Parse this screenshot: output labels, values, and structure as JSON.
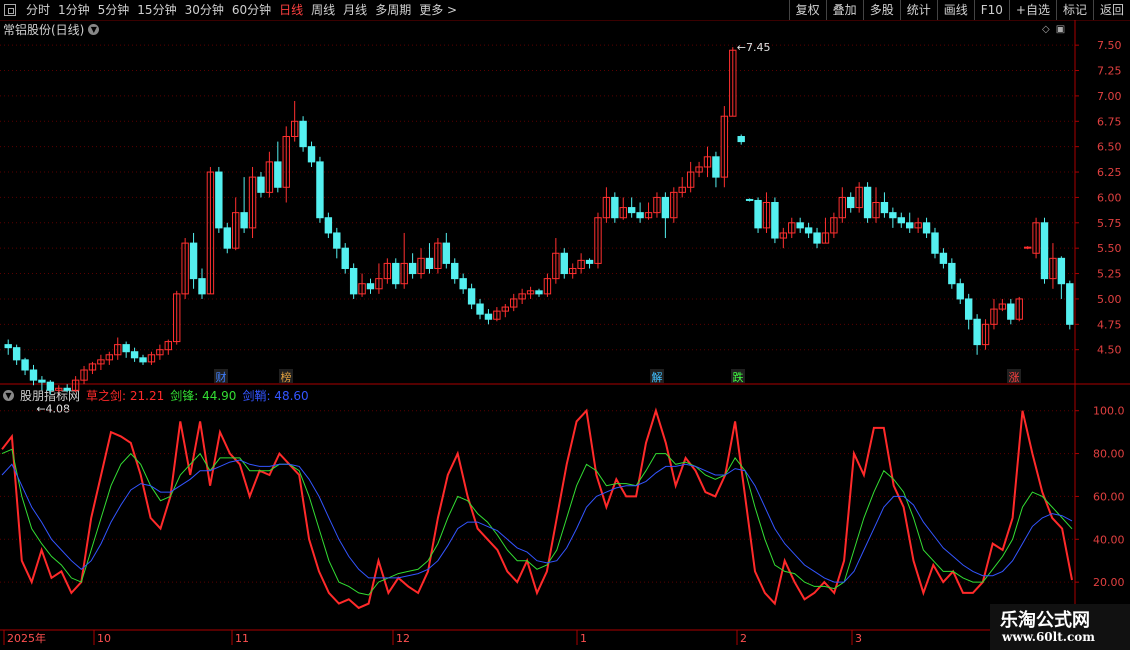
{
  "toolbar": {
    "periods": [
      "分时",
      "1分钟",
      "5分钟",
      "15分钟",
      "30分钟",
      "60分钟",
      "日线",
      "周线",
      "月线",
      "多周期",
      "更多 >"
    ],
    "active_period": "日线",
    "right_buttons": [
      "复权",
      "叠加",
      "多股",
      "统计",
      "画线",
      "F10",
      "+自选",
      "标记",
      "返回"
    ]
  },
  "main_chart": {
    "title": "常铝股份(日线)",
    "high_label": "7.45",
    "low_label": "4.08",
    "y_ticks": [
      "7.50",
      "7.25",
      "7.00",
      "6.75",
      "6.50",
      "6.25",
      "6.00",
      "5.75",
      "5.50",
      "5.25",
      "5.00",
      "4.75",
      "4.50"
    ],
    "event_markers": [
      "财",
      "榜",
      "解",
      "跌",
      "涨"
    ]
  },
  "indicator": {
    "name": "股朋指标网",
    "series_labels": [
      {
        "label": "草之剑: 21.21",
        "color": "#ff2a2a"
      },
      {
        "label": "剑锋: 44.90",
        "color": "#33dd33"
      },
      {
        "label": "剑鞘: 48.60",
        "color": "#3355ff"
      }
    ],
    "y_ticks": [
      "100.0",
      "80.00",
      "60.00",
      "40.00",
      "20.00"
    ]
  },
  "x_axis": {
    "labels": [
      "2025年",
      "10",
      "11",
      "12",
      "1",
      "2",
      "3"
    ]
  },
  "watermark": {
    "line1": "乐淘公式网",
    "line2": "www.60lt.com"
  },
  "colors": {
    "up": "#ff3030",
    "down": "#54f0f0",
    "grid": "#5a0000",
    "axis": "#aa0000"
  },
  "chart_data": [
    {
      "type": "candlestick",
      "ylim": [
        4.3,
        7.6
      ],
      "candles": [
        [
          4.55,
          4.52,
          4.6,
          4.45
        ],
        [
          4.52,
          4.4,
          4.55,
          4.35
        ],
        [
          4.4,
          4.3,
          4.42,
          4.25
        ],
        [
          4.3,
          4.2,
          4.35,
          4.15
        ],
        [
          4.2,
          4.18,
          4.24,
          4.1
        ],
        [
          4.18,
          4.1,
          4.2,
          4.06
        ],
        [
          4.1,
          4.12,
          4.15,
          4.08
        ],
        [
          4.12,
          4.1,
          4.16,
          4.08
        ],
        [
          4.1,
          4.2,
          4.24,
          4.08
        ],
        [
          4.2,
          4.3,
          4.34,
          4.16
        ],
        [
          4.3,
          4.36,
          4.38,
          4.26
        ],
        [
          4.36,
          4.4,
          4.45,
          4.3
        ],
        [
          4.4,
          4.45,
          4.48,
          4.35
        ],
        [
          4.45,
          4.55,
          4.62,
          4.4
        ],
        [
          4.55,
          4.48,
          4.58,
          4.42
        ],
        [
          4.48,
          4.42,
          4.52,
          4.38
        ],
        [
          4.42,
          4.38,
          4.45,
          4.35
        ],
        [
          4.38,
          4.45,
          4.48,
          4.35
        ],
        [
          4.45,
          4.5,
          4.55,
          4.4
        ],
        [
          4.5,
          4.58,
          4.6,
          4.45
        ],
        [
          4.58,
          5.05,
          5.08,
          4.55
        ],
        [
          5.05,
          5.55,
          5.6,
          5.0
        ],
        [
          5.55,
          5.2,
          5.65,
          5.1
        ],
        [
          5.2,
          5.05,
          5.3,
          5.0
        ],
        [
          5.05,
          6.25,
          6.3,
          5.05
        ],
        [
          6.25,
          5.7,
          6.3,
          5.65
        ],
        [
          5.7,
          5.5,
          5.75,
          5.45
        ],
        [
          5.5,
          5.85,
          6.0,
          5.48
        ],
        [
          5.85,
          5.7,
          6.2,
          5.65
        ],
        [
          5.7,
          6.2,
          6.3,
          5.6
        ],
        [
          6.2,
          6.05,
          6.25,
          6.0
        ],
        [
          6.05,
          6.35,
          6.45,
          6.0
        ],
        [
          6.35,
          6.1,
          6.55,
          6.05
        ],
        [
          6.1,
          6.6,
          6.7,
          5.95
        ],
        [
          6.6,
          6.75,
          6.95,
          6.55
        ],
        [
          6.75,
          6.5,
          6.8,
          6.45
        ],
        [
          6.5,
          6.35,
          6.55,
          6.3
        ],
        [
          6.35,
          5.8,
          6.4,
          5.75
        ],
        [
          5.8,
          5.65,
          5.85,
          5.6
        ],
        [
          5.65,
          5.5,
          5.7,
          5.4
        ],
        [
          5.5,
          5.3,
          5.55,
          5.25
        ],
        [
          5.3,
          5.05,
          5.35,
          5.0
        ],
        [
          5.05,
          5.15,
          5.25,
          5.02
        ],
        [
          5.15,
          5.1,
          5.2,
          5.05
        ],
        [
          5.1,
          5.2,
          5.35,
          5.05
        ],
        [
          5.2,
          5.35,
          5.4,
          5.15
        ],
        [
          5.35,
          5.15,
          5.4,
          5.1
        ],
        [
          5.15,
          5.35,
          5.65,
          5.1
        ],
        [
          5.35,
          5.25,
          5.45,
          5.2
        ],
        [
          5.25,
          5.4,
          5.5,
          5.2
        ],
        [
          5.4,
          5.3,
          5.55,
          5.25
        ],
        [
          5.3,
          5.55,
          5.6,
          5.25
        ],
        [
          5.55,
          5.35,
          5.65,
          5.3
        ],
        [
          5.35,
          5.2,
          5.4,
          5.15
        ],
        [
          5.2,
          5.1,
          5.25,
          5.05
        ],
        [
          5.1,
          4.95,
          5.15,
          4.9
        ],
        [
          4.95,
          4.85,
          5.0,
          4.8
        ],
        [
          4.85,
          4.8,
          4.9,
          4.75
        ],
        [
          4.8,
          4.88,
          4.92,
          4.78
        ],
        [
          4.88,
          4.92,
          4.95,
          4.82
        ],
        [
          4.92,
          5.0,
          5.05,
          4.88
        ],
        [
          5.0,
          5.05,
          5.1,
          4.95
        ],
        [
          5.05,
          5.08,
          5.12,
          5.0
        ],
        [
          5.08,
          5.05,
          5.1,
          5.02
        ],
        [
          5.05,
          5.2,
          5.25,
          5.02
        ],
        [
          5.2,
          5.45,
          5.6,
          5.15
        ],
        [
          5.45,
          5.25,
          5.5,
          5.2
        ],
        [
          5.25,
          5.3,
          5.35,
          5.2
        ],
        [
          5.3,
          5.38,
          5.45,
          5.25
        ],
        [
          5.38,
          5.35,
          5.4,
          5.3
        ],
        [
          5.35,
          5.8,
          5.85,
          5.3
        ],
        [
          5.8,
          6.0,
          6.1,
          5.75
        ],
        [
          6.0,
          5.8,
          6.05,
          5.75
        ],
        [
          5.8,
          5.9,
          6.0,
          5.78
        ],
        [
          5.9,
          5.85,
          6.0,
          5.8
        ],
        [
          5.85,
          5.8,
          5.95,
          5.75
        ],
        [
          5.8,
          5.85,
          5.95,
          5.78
        ],
        [
          5.85,
          6.0,
          6.05,
          5.8
        ],
        [
          6.0,
          5.8,
          6.05,
          5.6
        ],
        [
          5.8,
          6.05,
          6.1,
          5.75
        ],
        [
          6.05,
          6.1,
          6.2,
          6.0
        ],
        [
          6.1,
          6.25,
          6.35,
          6.05
        ],
        [
          6.25,
          6.3,
          6.35,
          6.2
        ],
        [
          6.3,
          6.4,
          6.5,
          6.2
        ],
        [
          6.4,
          6.2,
          6.45,
          6.1
        ],
        [
          6.2,
          6.8,
          6.9,
          6.1
        ],
        [
          6.8,
          7.45,
          7.48,
          6.8
        ],
        [
          6.6,
          6.55,
          6.62,
          6.52
        ],
        [
          5.98,
          5.97,
          5.99,
          5.96
        ],
        [
          5.97,
          5.7,
          6.0,
          5.65
        ],
        [
          5.7,
          5.95,
          6.05,
          5.65
        ],
        [
          5.95,
          5.6,
          6.0,
          5.55
        ],
        [
          5.6,
          5.65,
          5.7,
          5.5
        ],
        [
          5.65,
          5.75,
          5.8,
          5.6
        ],
        [
          5.75,
          5.7,
          5.8,
          5.65
        ],
        [
          5.7,
          5.65,
          5.75,
          5.6
        ],
        [
          5.65,
          5.55,
          5.7,
          5.5
        ],
        [
          5.55,
          5.65,
          5.8,
          5.55
        ],
        [
          5.65,
          5.8,
          5.85,
          5.6
        ],
        [
          5.8,
          6.0,
          6.1,
          5.75
        ],
        [
          6.0,
          5.9,
          6.05,
          5.85
        ],
        [
          5.9,
          6.1,
          6.15,
          5.85
        ],
        [
          6.1,
          5.8,
          6.15,
          5.75
        ],
        [
          5.8,
          5.95,
          6.1,
          5.75
        ],
        [
          5.95,
          5.85,
          6.05,
          5.8
        ],
        [
          5.85,
          5.8,
          5.9,
          5.7
        ],
        [
          5.8,
          5.75,
          5.85,
          5.7
        ],
        [
          5.75,
          5.7,
          5.85,
          5.65
        ],
        [
          5.7,
          5.75,
          5.8,
          5.65
        ],
        [
          5.75,
          5.65,
          5.8,
          5.6
        ],
        [
          5.65,
          5.45,
          5.7,
          5.4
        ],
        [
          5.45,
          5.35,
          5.5,
          5.3
        ],
        [
          5.35,
          5.15,
          5.4,
          5.1
        ],
        [
          5.15,
          5.0,
          5.2,
          4.95
        ],
        [
          5.0,
          4.8,
          5.05,
          4.7
        ],
        [
          4.8,
          4.55,
          4.85,
          4.45
        ],
        [
          4.55,
          4.75,
          4.8,
          4.5
        ],
        [
          4.75,
          4.9,
          5.0,
          4.7
        ],
        [
          4.9,
          4.95,
          5.0,
          4.88
        ],
        [
          4.95,
          4.8,
          5.0,
          4.75
        ],
        [
          4.8,
          5.0,
          5.02,
          4.78
        ],
        [
          5.5,
          5.51,
          5.52,
          5.49
        ],
        [
          5.45,
          5.75,
          5.8,
          5.4
        ],
        [
          5.75,
          5.2,
          5.8,
          5.15
        ],
        [
          5.2,
          5.4,
          5.55,
          5.1
        ],
        [
          5.4,
          5.15,
          5.42,
          5.0
        ],
        [
          5.15,
          4.75,
          5.18,
          4.7
        ]
      ]
    },
    {
      "type": "line",
      "ylim": [
        0,
        105
      ],
      "series": [
        {
          "name": "草之剑",
          "values": [
            82,
            88,
            30,
            20,
            35,
            22,
            25,
            15,
            20,
            50,
            70,
            90,
            88,
            85,
            70,
            50,
            45,
            60,
            95,
            70,
            95,
            65,
            90,
            80,
            75,
            60,
            72,
            70,
            80,
            75,
            70,
            40,
            25,
            15,
            10,
            12,
            8,
            10,
            30,
            15,
            22,
            18,
            15,
            25,
            50,
            70,
            80,
            60,
            45,
            40,
            35,
            25,
            20,
            30,
            15,
            25,
            50,
            75,
            95,
            100,
            70,
            55,
            68,
            60,
            60,
            85,
            100,
            85,
            65,
            78,
            72,
            62,
            60,
            70,
            95,
            60,
            25,
            15,
            10,
            30,
            20,
            12,
            15,
            20,
            15,
            30,
            80,
            70,
            92,
            92,
            65,
            55,
            30,
            15,
            28,
            20,
            25,
            15,
            15,
            20,
            38,
            35,
            50,
            100,
            80,
            62,
            50,
            45,
            21
          ]
        },
        {
          "name": "剑锋",
          "values": [
            80,
            82,
            60,
            45,
            38,
            32,
            28,
            22,
            20,
            35,
            50,
            65,
            75,
            80,
            75,
            65,
            58,
            60,
            70,
            75,
            80,
            72,
            78,
            78,
            78,
            72,
            72,
            72,
            75,
            75,
            72,
            60,
            45,
            30,
            20,
            18,
            15,
            14,
            20,
            22,
            24,
            25,
            26,
            30,
            38,
            50,
            60,
            58,
            52,
            48,
            42,
            35,
            30,
            30,
            26,
            28,
            35,
            50,
            65,
            75,
            72,
            65,
            66,
            66,
            65,
            72,
            80,
            80,
            75,
            76,
            74,
            70,
            68,
            70,
            78,
            72,
            55,
            40,
            28,
            25,
            24,
            20,
            18,
            18,
            17,
            20,
            35,
            50,
            62,
            72,
            68,
            62,
            50,
            35,
            30,
            25,
            25,
            22,
            20,
            20,
            26,
            32,
            40,
            55,
            62,
            60,
            55,
            50,
            44.9
          ]
        },
        {
          "name": "剑鞘",
          "values": [
            70,
            75,
            65,
            55,
            48,
            40,
            35,
            30,
            26,
            30,
            38,
            48,
            56,
            63,
            66,
            65,
            62,
            62,
            65,
            68,
            72,
            72,
            74,
            76,
            77,
            75,
            74,
            74,
            75,
            75,
            74,
            68,
            60,
            50,
            40,
            32,
            26,
            22,
            22,
            22,
            22,
            23,
            24,
            26,
            30,
            37,
            45,
            48,
            48,
            46,
            44,
            40,
            36,
            34,
            30,
            29,
            30,
            36,
            45,
            55,
            60,
            62,
            64,
            65,
            65,
            67,
            71,
            74,
            74,
            75,
            74,
            72,
            70,
            70,
            73,
            72,
            65,
            55,
            45,
            38,
            33,
            28,
            25,
            22,
            20,
            20,
            25,
            35,
            45,
            55,
            60,
            60,
            56,
            48,
            42,
            36,
            32,
            28,
            25,
            23,
            23,
            25,
            30,
            38,
            46,
            50,
            52,
            51,
            48.6
          ]
        }
      ]
    }
  ]
}
